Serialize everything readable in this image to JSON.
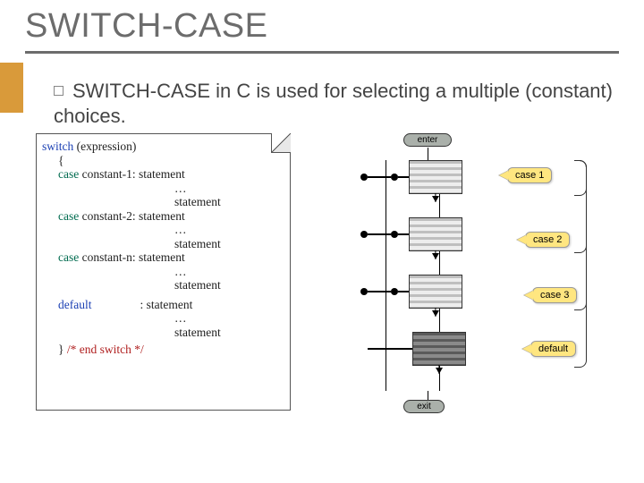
{
  "slide": {
    "title": "SWITCH-CASE",
    "bullet": "SWITCH-CASE in C is used for selecting a multiple (constant) choices."
  },
  "code": {
    "switch_kw": "switch",
    "expr": " (expression)",
    "open": "{",
    "case_kw": "case",
    "const1": " constant-1: ",
    "const2": " constant-2: ",
    "constn": " constant-n: ",
    "stmt": "statement",
    "dots": "…",
    "default_kw": "default",
    "default_sep": "                : ",
    "close": "}",
    "comment": " /* end switch */"
  },
  "flow": {
    "enter": "enter",
    "exit": "exit",
    "case1": "case 1",
    "case2": "case 2",
    "case3": "case 3",
    "default": "default"
  }
}
